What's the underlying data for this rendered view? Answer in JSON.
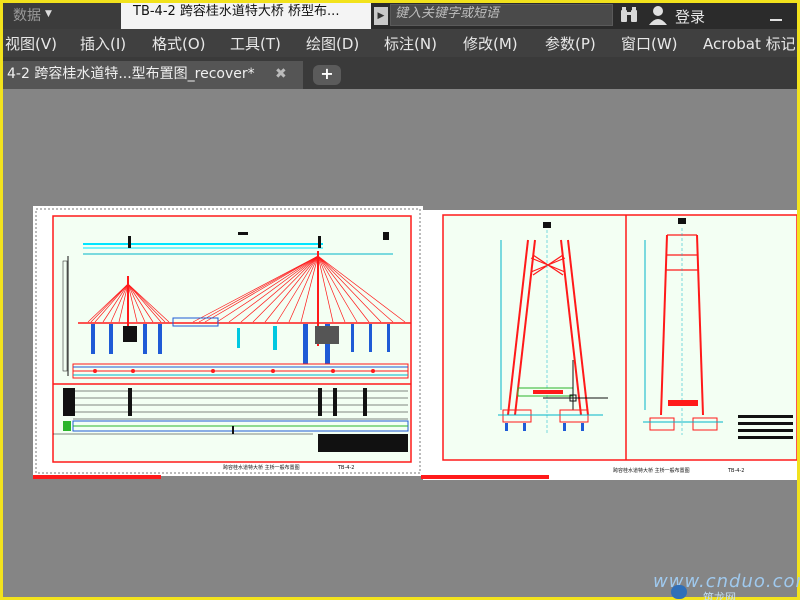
{
  "titlebar": {
    "quick_access_label": "数据",
    "document_title": "TB-4-2 跨容桂水道特大桥 桥型布...",
    "search_placeholder": "键入关键字或短语",
    "login_label": "登录"
  },
  "menu": {
    "items": [
      "视图(V)",
      "插入(I)",
      "格式(O)",
      "工具(T)",
      "绘图(D)",
      "标注(N)",
      "修改(M)",
      "参数(P)",
      "窗口(W)",
      "Acrobat 标记"
    ]
  },
  "tabs": {
    "active_label": "4-2 跨容桂水道特...型布置图_recover*",
    "close_glyph": "✖",
    "new_glyph": "+"
  },
  "drawing": {
    "sheet1_footer": "跨容桂水道特大桥 主桥一般布置图",
    "sheet1_code": "TB-4-2",
    "sheet2_footer": "跨容桂水道特大桥 主桥一般布置图",
    "sheet2_code": "TB-4-2"
  },
  "watermark": {
    "text": "www.cnduo.com",
    "sub_text": "筑龙网"
  },
  "colors": {
    "title_bg": "#2b2b2b",
    "menu_bg": "#404040",
    "canvas_bg": "#858585",
    "drawing_red": "#ff1a1a",
    "drawing_cyan": "#00e5ff",
    "paper_green": "#f0fff0",
    "frame_yellow": "#f2e21c"
  },
  "icons": {
    "binoculars": "binoculars-icon",
    "user": "user-icon",
    "minimize": "minimize-icon",
    "tab_close": "close-icon",
    "new_tab": "plus-icon"
  }
}
